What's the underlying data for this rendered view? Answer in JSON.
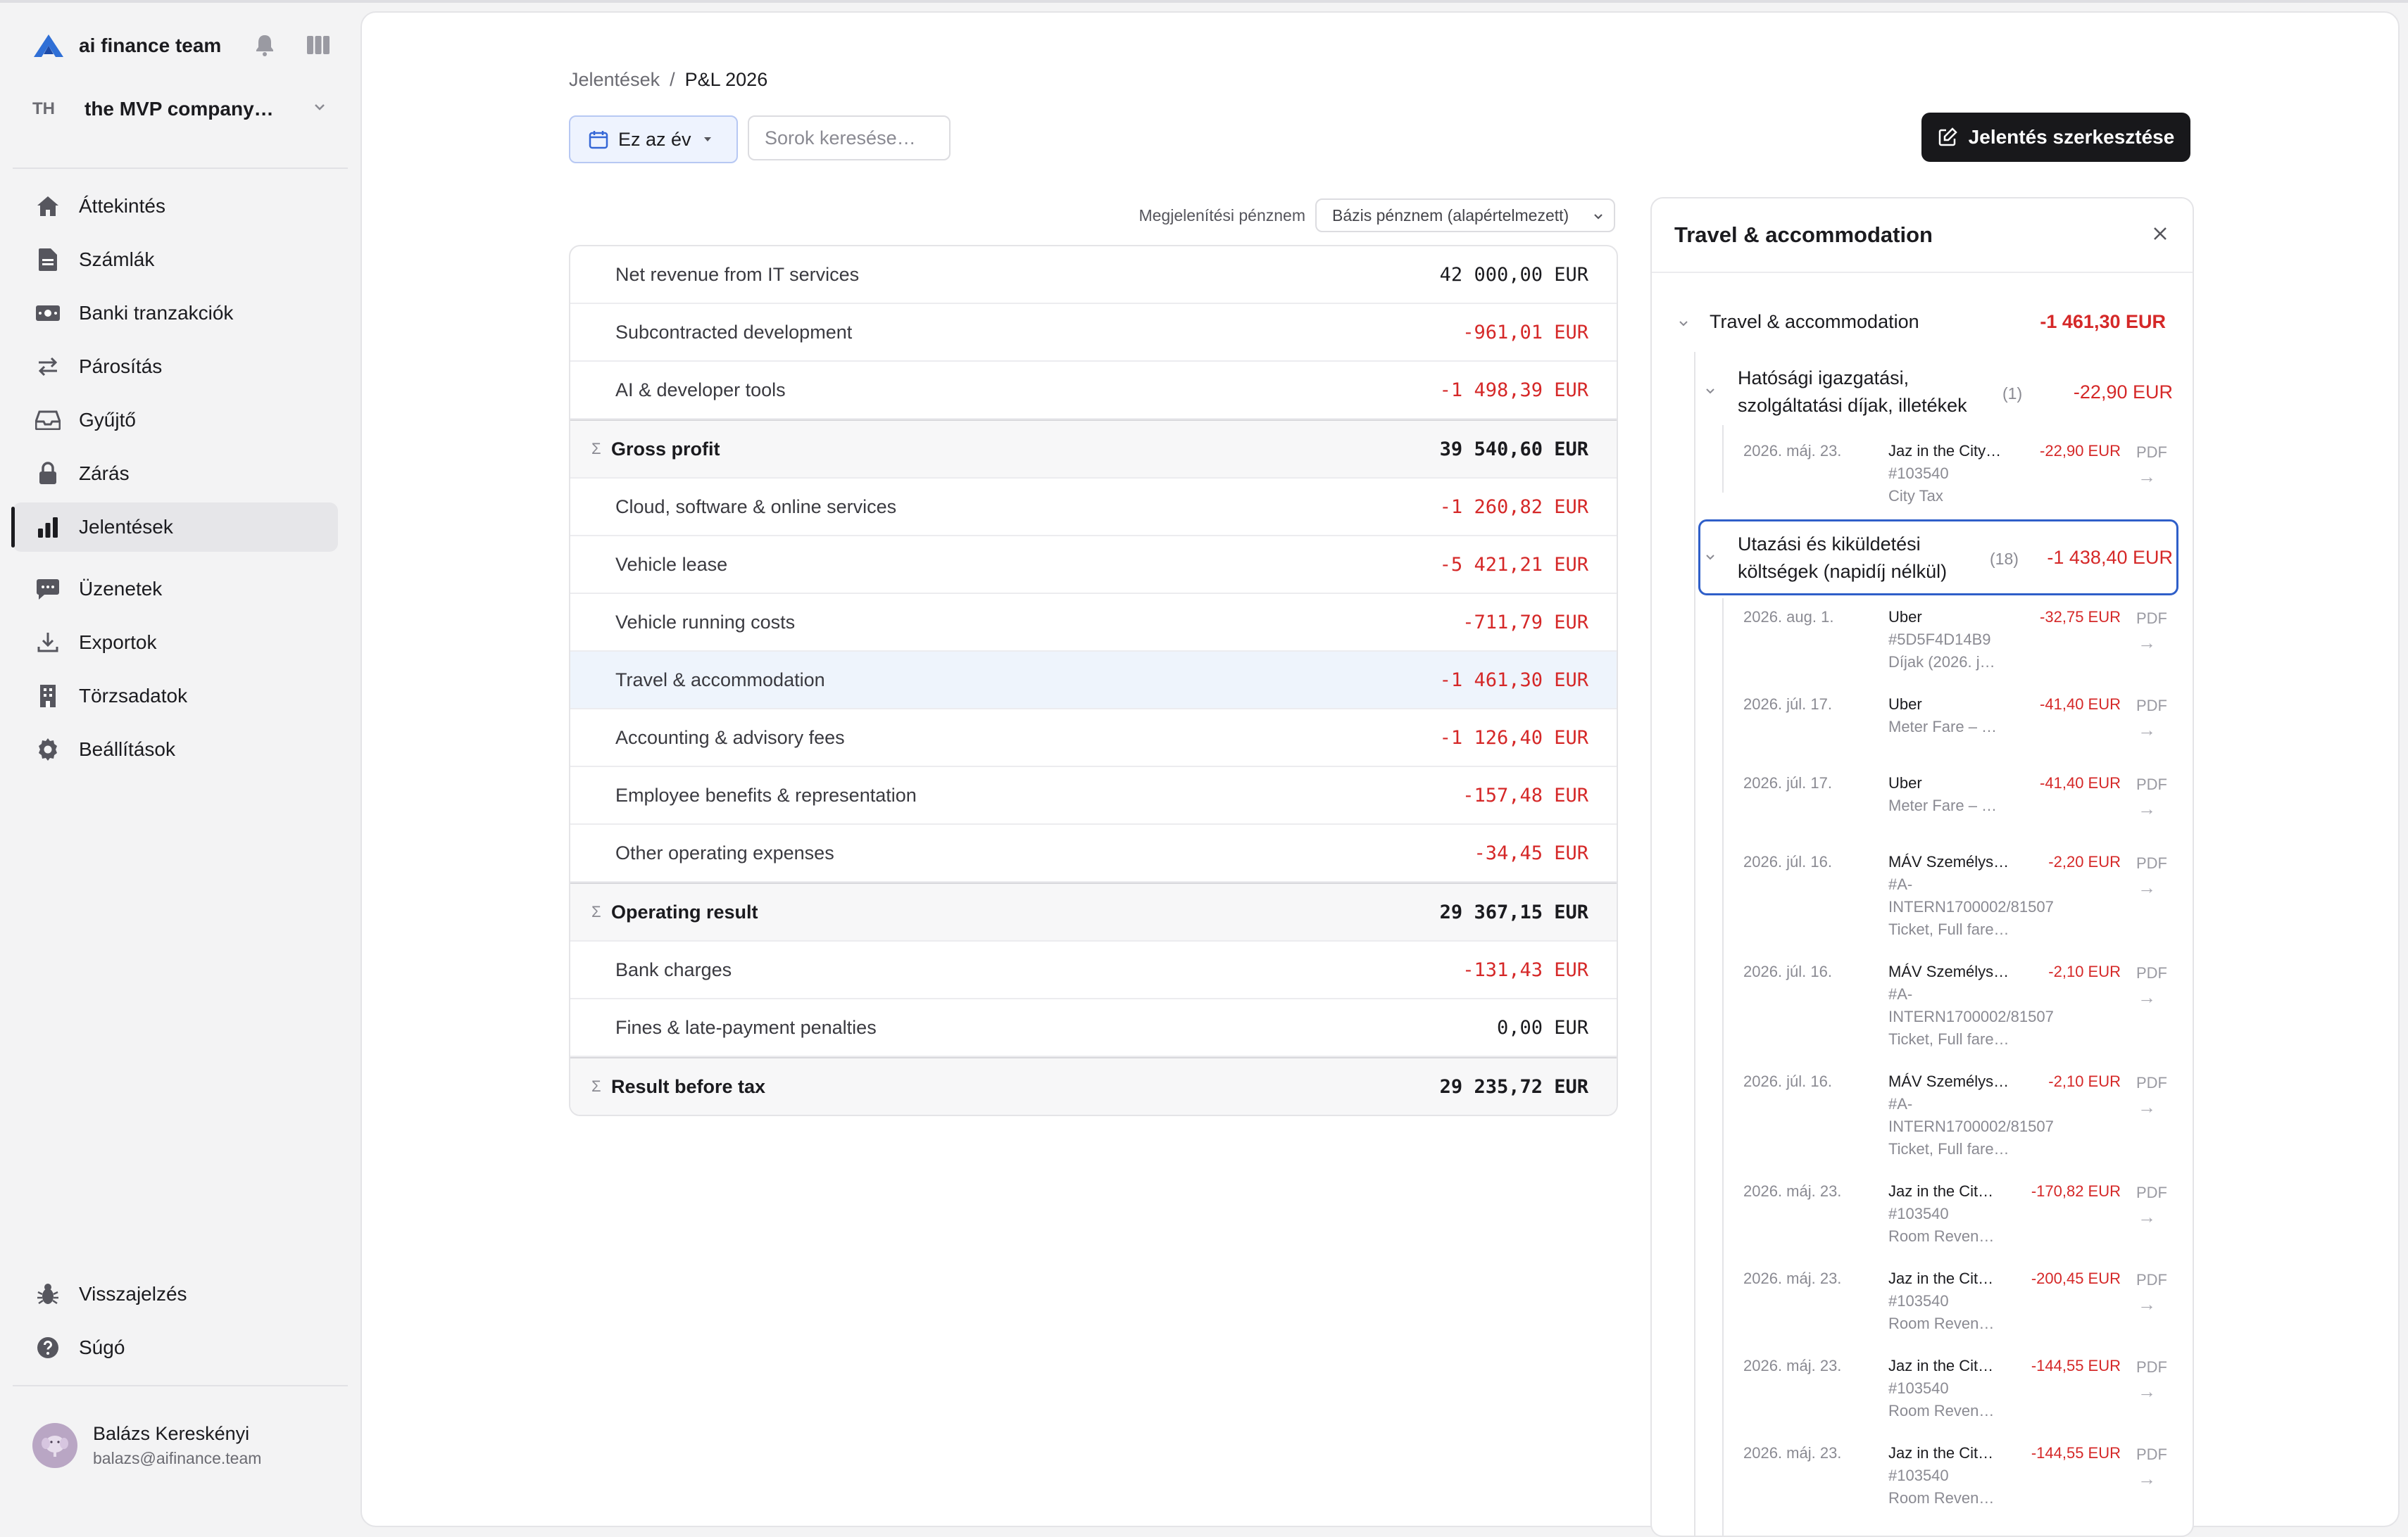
{
  "sidebar": {
    "brand_name": "ai finance team",
    "company_initials": "TH",
    "company_name": "the MVP company…",
    "nav": [
      {
        "label": "Áttekintés",
        "icon": "home-icon"
      },
      {
        "label": "Számlák",
        "icon": "document-icon"
      },
      {
        "label": "Banki tranzakciók",
        "icon": "banknote-icon"
      },
      {
        "label": "Párosítás",
        "icon": "swap-arrows-icon"
      },
      {
        "label": "Gyűjtő",
        "icon": "inbox-icon"
      },
      {
        "label": "Zárás",
        "icon": "lock-icon"
      },
      {
        "label": "Jelentések",
        "icon": "bar-chart-icon",
        "active": true
      }
    ],
    "nav2": [
      {
        "label": "Üzenetek",
        "icon": "chat-icon"
      },
      {
        "label": "Exportok",
        "icon": "download-icon"
      },
      {
        "label": "Törzsadatok",
        "icon": "building-icon"
      },
      {
        "label": "Beállítások",
        "icon": "gear-icon"
      }
    ],
    "bottom": [
      {
        "label": "Visszajelzés",
        "icon": "bug-icon"
      },
      {
        "label": "Súgó",
        "icon": "help-icon"
      }
    ],
    "user": {
      "name": "Balázs Kereskényi",
      "email": "balazs@aifinance.team"
    }
  },
  "header": {
    "breadcrumb_parent": "Jelentések",
    "breadcrumb_sep": "/",
    "breadcrumb_current": "P&L 2026",
    "period_label": "Ez az év",
    "search_placeholder": "Sorok keresése…",
    "edit_label": "Jelentés szerkesztése",
    "currency_label": "Megjelenítési pénznem",
    "currency_value": "Bázis pénznem (alapértelmezett)"
  },
  "pl_rows": [
    {
      "name": "Net revenue from IT services",
      "amount": "42 000,00 EUR",
      "type": "line",
      "negative": false
    },
    {
      "name": "Subcontracted development",
      "amount": "-961,01 EUR",
      "type": "line",
      "negative": true
    },
    {
      "name": "AI & developer tools",
      "amount": "-1 498,39 EUR",
      "type": "line",
      "negative": true
    },
    {
      "name": "Gross profit",
      "amount": "39 540,60 EUR",
      "type": "sum",
      "negative": false
    },
    {
      "name": "Cloud, software & online services",
      "amount": "-1 260,82 EUR",
      "type": "line",
      "negative": true
    },
    {
      "name": "Vehicle lease",
      "amount": "-5 421,21 EUR",
      "type": "line",
      "negative": true
    },
    {
      "name": "Vehicle running costs",
      "amount": "-711,79 EUR",
      "type": "line",
      "negative": true
    },
    {
      "name": "Travel & accommodation",
      "amount": "-1 461,30 EUR",
      "type": "line",
      "negative": true,
      "selected": true
    },
    {
      "name": "Accounting & advisory fees",
      "amount": "-1 126,40 EUR",
      "type": "line",
      "negative": true
    },
    {
      "name": "Employee benefits & representation",
      "amount": "-157,48 EUR",
      "type": "line",
      "negative": true
    },
    {
      "name": "Other operating expenses",
      "amount": "-34,45 EUR",
      "type": "line",
      "negative": true
    },
    {
      "name": "Operating result",
      "amount": "29 367,15 EUR",
      "type": "sum",
      "negative": false
    },
    {
      "name": "Bank charges",
      "amount": "-131,43 EUR",
      "type": "line",
      "negative": true
    },
    {
      "name": "Fines & late-payment penalties",
      "amount": "0,00 EUR",
      "type": "line",
      "negative": false
    },
    {
      "name": "Result before tax",
      "amount": "29 235,72 EUR",
      "type": "sum",
      "negative": false
    }
  ],
  "sigma": "Σ",
  "detail": {
    "title": "Travel & accommodation",
    "category": {
      "name": "Travel & accommodation",
      "amount": "-1 461,30 EUR"
    },
    "sub1": {
      "name_line1": "Hatósági igazgatási,",
      "name_line2": "szolgáltatási díjak, illetékek",
      "count": "(1)",
      "amount": "-22,90 EUR"
    },
    "sub1_tx": [
      {
        "date": "2026. máj. 23.",
        "vendor": "Jaz in the City…",
        "lines": [
          "#103540",
          "City Tax"
        ],
        "amount": "-22,90 EUR"
      }
    ],
    "sub2": {
      "name_line1": "Utazási és kiküldetési",
      "name_line2": "költségek (napidíj nélkül)",
      "count": "(18)",
      "amount": "-1 438,40 EUR"
    },
    "sub2_tx": [
      {
        "date": "2026. aug. 1.",
        "vendor": "Uber",
        "lines": [
          "#5D5F4D14B9",
          "Díjak (2026. j…"
        ],
        "amount": "-32,75 EUR"
      },
      {
        "date": "2026. júl. 17.",
        "vendor": "Uber",
        "lines": [
          "Meter Fare – …"
        ],
        "amount": "-41,40 EUR"
      },
      {
        "date": "2026. júl. 17.",
        "vendor": "Uber",
        "lines": [
          "Meter Fare – …"
        ],
        "amount": "-41,40 EUR"
      },
      {
        "date": "2026. júl. 16.",
        "vendor": "MÁV Személys…",
        "lines": [
          "#A-",
          "INTERN1700002/81507",
          "Ticket, Full fare…"
        ],
        "amount": "-2,20 EUR"
      },
      {
        "date": "2026. júl. 16.",
        "vendor": "MÁV Személys…",
        "lines": [
          "#A-",
          "INTERN1700002/81507",
          "Ticket, Full fare…"
        ],
        "amount": "-2,10 EUR"
      },
      {
        "date": "2026. júl. 16.",
        "vendor": "MÁV Személys…",
        "lines": [
          "#A-",
          "INTERN1700002/81507",
          "Ticket, Full fare…"
        ],
        "amount": "-2,10 EUR"
      },
      {
        "date": "2026. máj. 23.",
        "vendor": "Jaz in the Cit…",
        "lines": [
          "#103540",
          "Room Reven…"
        ],
        "amount": "-170,82 EUR"
      },
      {
        "date": "2026. máj. 23.",
        "vendor": "Jaz in the Cit…",
        "lines": [
          "#103540",
          "Room Reven…"
        ],
        "amount": "-200,45 EUR"
      },
      {
        "date": "2026. máj. 23.",
        "vendor": "Jaz in the Cit…",
        "lines": [
          "#103540",
          "Room Reven…"
        ],
        "amount": "-144,55 EUR"
      },
      {
        "date": "2026. máj. 23.",
        "vendor": "Jaz in the Cit…",
        "lines": [
          "#103540",
          "Room Reven…"
        ],
        "amount": "-144,55 EUR"
      }
    ],
    "pdf_label": "PDF",
    "arrow": "→"
  },
  "colors": {
    "negative": "#d52828",
    "accent": "#2f5fc9",
    "selected_row": "#eef4fc"
  }
}
